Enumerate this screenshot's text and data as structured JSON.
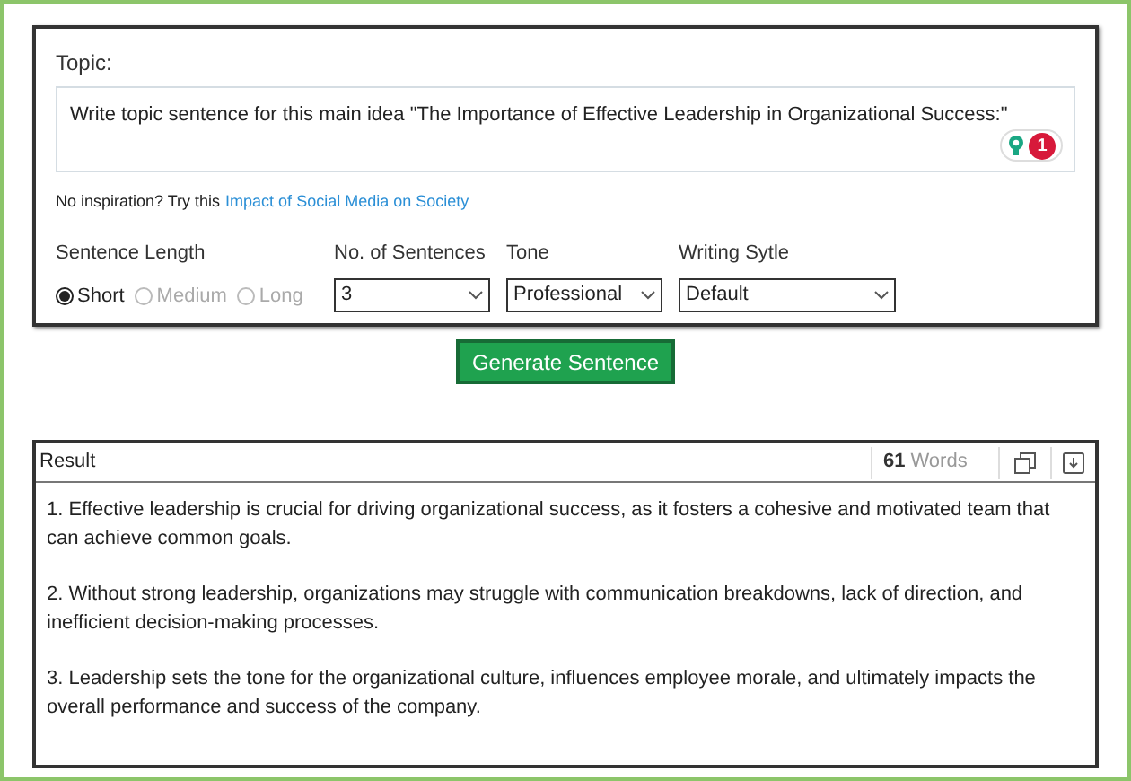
{
  "topic": {
    "label": "Topic:",
    "value": "Write topic sentence for this main idea \"The Importance of Effective Leadership in Organizational Success:\"",
    "badge": "1"
  },
  "inspiration": {
    "prompt": "No inspiration? Try this",
    "link": "Impact of Social Media on Society"
  },
  "sentence_length": {
    "label": "Sentence Length",
    "options": [
      {
        "label": "Short",
        "selected": true
      },
      {
        "label": "Medium",
        "selected": false
      },
      {
        "label": "Long",
        "selected": false
      }
    ]
  },
  "selects": [
    {
      "label": "No. of Sentences",
      "value": "3"
    },
    {
      "label": "Tone",
      "value": "Professional"
    },
    {
      "label": "Writing Sytle",
      "value": "Default"
    }
  ],
  "generate_button": "Generate Sentence",
  "result": {
    "title": "Result",
    "word_count": "61",
    "word_unit": "Words",
    "paragraphs": [
      "1. Effective leadership is crucial for driving organizational success, as it fosters a cohesive and motivated team that can achieve common goals.",
      "2. Without strong leadership, organizations may struggle with communication breakdowns, lack of direction, and inefficient decision-making processes.",
      "3. Leadership sets the tone for the organizational culture, influences employee morale, and ultimately impacts the overall performance and success of the company."
    ]
  }
}
